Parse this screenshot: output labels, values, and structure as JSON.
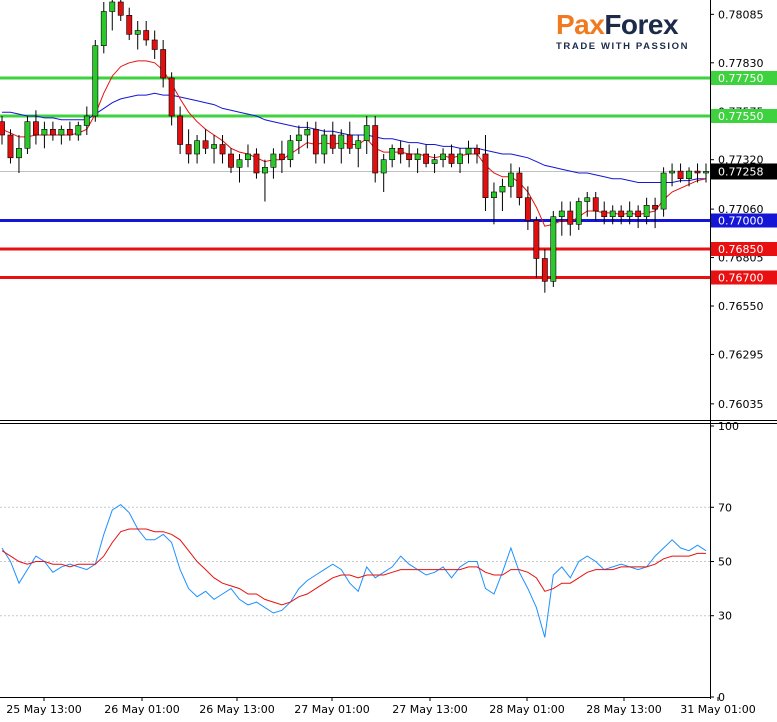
{
  "brand": {
    "name_part1": "Pax",
    "name_part2": "Forex",
    "tagline": "TRADE WITH PASSION",
    "color_primary": "#f07a20",
    "color_secondary": "#1c2b4a"
  },
  "chart_data": [
    {
      "type": "candlestick",
      "symbol_pane": "price",
      "y_ticks": [
        "0.78085",
        "0.77830",
        "0.77575",
        "0.77320",
        "0.77060",
        "0.76805",
        "0.76550",
        "0.76295",
        "0.76035"
      ],
      "ylim": [
        0.7595,
        0.7815
      ],
      "current_price": "0.77258",
      "current_price_value": 0.77258,
      "levels": [
        {
          "label": "0.77750",
          "value": 0.7775,
          "color": "#3fd23f"
        },
        {
          "label": "0.77550",
          "value": 0.7755,
          "color": "#3fd23f"
        },
        {
          "label": "0.77000",
          "value": 0.77,
          "color": "#1515d6"
        },
        {
          "label": "0.76850",
          "value": 0.7685,
          "color": "#e81010"
        },
        {
          "label": "0.76700",
          "value": 0.767,
          "color": "#e81010"
        }
      ],
      "candles": [
        [
          0.7752,
          0.7755,
          0.774,
          0.7745
        ],
        [
          0.7745,
          0.7748,
          0.773,
          0.7733
        ],
        [
          0.7733,
          0.7745,
          0.7725,
          0.7738
        ],
        [
          0.7738,
          0.7755,
          0.7735,
          0.7752
        ],
        [
          0.7752,
          0.7758,
          0.774,
          0.7745
        ],
        [
          0.7745,
          0.7752,
          0.7738,
          0.7748
        ],
        [
          0.7748,
          0.7752,
          0.7742,
          0.7745
        ],
        [
          0.7745,
          0.775,
          0.774,
          0.7748
        ],
        [
          0.7748,
          0.7752,
          0.7742,
          0.7745
        ],
        [
          0.7745,
          0.7752,
          0.7742,
          0.775
        ],
        [
          0.775,
          0.776,
          0.7745,
          0.7755
        ],
        [
          0.7755,
          0.7795,
          0.7752,
          0.7792
        ],
        [
          0.7792,
          0.7815,
          0.7788,
          0.781
        ],
        [
          0.781,
          0.782,
          0.78,
          0.7815
        ],
        [
          0.7815,
          0.782,
          0.7805,
          0.7808
        ],
        [
          0.7808,
          0.7812,
          0.7795,
          0.7798
        ],
        [
          0.7798,
          0.7805,
          0.779,
          0.78
        ],
        [
          0.78,
          0.7805,
          0.7792,
          0.7795
        ],
        [
          0.7795,
          0.78,
          0.7785,
          0.779
        ],
        [
          0.779,
          0.7795,
          0.777,
          0.7775
        ],
        [
          0.7775,
          0.7778,
          0.775,
          0.7755
        ],
        [
          0.7755,
          0.776,
          0.7735,
          0.774
        ],
        [
          0.774,
          0.7748,
          0.773,
          0.7735
        ],
        [
          0.7735,
          0.7745,
          0.773,
          0.7742
        ],
        [
          0.7742,
          0.7748,
          0.7735,
          0.7738
        ],
        [
          0.7738,
          0.7745,
          0.773,
          0.774
        ],
        [
          0.774,
          0.7745,
          0.773,
          0.7735
        ],
        [
          0.7735,
          0.7738,
          0.7725,
          0.7728
        ],
        [
          0.7728,
          0.7735,
          0.772,
          0.7732
        ],
        [
          0.7732,
          0.774,
          0.7728,
          0.7735
        ],
        [
          0.7735,
          0.7738,
          0.7722,
          0.7725
        ],
        [
          0.7725,
          0.7732,
          0.771,
          0.7728
        ],
        [
          0.7728,
          0.7738,
          0.7722,
          0.7735
        ],
        [
          0.7735,
          0.7742,
          0.7725,
          0.7732
        ],
        [
          0.7732,
          0.7745,
          0.7728,
          0.7742
        ],
        [
          0.7742,
          0.775,
          0.7735,
          0.7745
        ],
        [
          0.7745,
          0.7752,
          0.7738,
          0.7748
        ],
        [
          0.7748,
          0.7752,
          0.773,
          0.7735
        ],
        [
          0.7735,
          0.7748,
          0.773,
          0.7745
        ],
        [
          0.7745,
          0.7752,
          0.7735,
          0.7738
        ],
        [
          0.7738,
          0.7748,
          0.773,
          0.7745
        ],
        [
          0.7745,
          0.7752,
          0.7735,
          0.7738
        ],
        [
          0.7738,
          0.7745,
          0.7728,
          0.7742
        ],
        [
          0.7742,
          0.7755,
          0.7735,
          0.775
        ],
        [
          0.775,
          0.7755,
          0.772,
          0.7725
        ],
        [
          0.7725,
          0.7735,
          0.7715,
          0.7732
        ],
        [
          0.7732,
          0.774,
          0.7728,
          0.7738
        ],
        [
          0.7738,
          0.7742,
          0.773,
          0.7735
        ],
        [
          0.7735,
          0.774,
          0.7728,
          0.7732
        ],
        [
          0.7732,
          0.7738,
          0.7725,
          0.7735
        ],
        [
          0.7735,
          0.774,
          0.7728,
          0.773
        ],
        [
          0.773,
          0.7735,
          0.7725,
          0.7732
        ],
        [
          0.7732,
          0.7738,
          0.7728,
          0.7735
        ],
        [
          0.7735,
          0.774,
          0.7728,
          0.773
        ],
        [
          0.773,
          0.7738,
          0.7725,
          0.7735
        ],
        [
          0.7735,
          0.7742,
          0.773,
          0.7738
        ],
        [
          0.7738,
          0.774,
          0.773,
          0.7735
        ],
        [
          0.7735,
          0.7745,
          0.7705,
          0.7712
        ],
        [
          0.7712,
          0.772,
          0.7698,
          0.7715
        ],
        [
          0.7715,
          0.7722,
          0.7705,
          0.7718
        ],
        [
          0.7718,
          0.773,
          0.7712,
          0.7725
        ],
        [
          0.7725,
          0.7728,
          0.7708,
          0.7712
        ],
        [
          0.7712,
          0.7718,
          0.7695,
          0.77
        ],
        [
          0.77,
          0.7702,
          0.767,
          0.768
        ],
        [
          0.768,
          0.7685,
          0.7662,
          0.7668
        ],
        [
          0.7668,
          0.7705,
          0.7665,
          0.7702
        ],
        [
          0.7702,
          0.771,
          0.7692,
          0.7705
        ],
        [
          0.7705,
          0.771,
          0.7692,
          0.7698
        ],
        [
          0.7698,
          0.7712,
          0.7695,
          0.771
        ],
        [
          0.771,
          0.7715,
          0.7702,
          0.7712
        ],
        [
          0.7712,
          0.7715,
          0.77,
          0.7705
        ],
        [
          0.7705,
          0.771,
          0.7698,
          0.7702
        ],
        [
          0.7702,
          0.7708,
          0.7698,
          0.7705
        ],
        [
          0.7705,
          0.7708,
          0.7698,
          0.7702
        ],
        [
          0.7702,
          0.771,
          0.7698,
          0.7705
        ],
        [
          0.7705,
          0.7708,
          0.7696,
          0.7702
        ],
        [
          0.7702,
          0.7712,
          0.7698,
          0.7708
        ],
        [
          0.7708,
          0.7712,
          0.7696,
          0.7706
        ],
        [
          0.7706,
          0.7728,
          0.7702,
          0.7725
        ],
        [
          0.7725,
          0.773,
          0.7718,
          0.7726
        ],
        [
          0.7726,
          0.773,
          0.772,
          0.7722
        ],
        [
          0.7722,
          0.7728,
          0.7718,
          0.7726
        ],
        [
          0.7726,
          0.773,
          0.772,
          0.7725
        ],
        [
          0.7725,
          0.773,
          0.772,
          0.77258
        ]
      ],
      "ma_fast": [
        0.7748,
        0.7746,
        0.7744,
        0.7744,
        0.7745,
        0.7745,
        0.7745,
        0.7745,
        0.7745,
        0.7746,
        0.7748,
        0.7756,
        0.7767,
        0.7776,
        0.7781,
        0.7783,
        0.7784,
        0.7784,
        0.7783,
        0.7779,
        0.7772,
        0.7764,
        0.7757,
        0.7752,
        0.7748,
        0.7745,
        0.7742,
        0.7738,
        0.7736,
        0.7735,
        0.7733,
        0.7731,
        0.7732,
        0.7732,
        0.7735,
        0.7738,
        0.7741,
        0.774,
        0.7741,
        0.774,
        0.7741,
        0.774,
        0.774,
        0.7743,
        0.7738,
        0.7736,
        0.7736,
        0.7736,
        0.7735,
        0.7735,
        0.7734,
        0.7733,
        0.7734,
        0.7733,
        0.7734,
        0.7735,
        0.7735,
        0.7729,
        0.7725,
        0.7723,
        0.7723,
        0.772,
        0.7715,
        0.7707,
        0.7697,
        0.7698,
        0.77,
        0.7699,
        0.7702,
        0.7705,
        0.7705,
        0.7704,
        0.7704,
        0.7703,
        0.7704,
        0.7703,
        0.7704,
        0.7705,
        0.7711,
        0.7715,
        0.7717,
        0.7719,
        0.7721,
        0.7722
      ],
      "ma_slow": [
        0.7757,
        0.7757,
        0.7756,
        0.7755,
        0.7755,
        0.7754,
        0.7754,
        0.7753,
        0.7753,
        0.7753,
        0.7753,
        0.7756,
        0.7759,
        0.7762,
        0.7764,
        0.7765,
        0.7766,
        0.7766,
        0.7767,
        0.7766,
        0.7766,
        0.7765,
        0.7764,
        0.7763,
        0.7762,
        0.7761,
        0.7759,
        0.7758,
        0.7757,
        0.7756,
        0.7755,
        0.7753,
        0.7752,
        0.7751,
        0.775,
        0.7749,
        0.7749,
        0.7748,
        0.7747,
        0.7747,
        0.7746,
        0.7745,
        0.7745,
        0.7745,
        0.7744,
        0.7743,
        0.7743,
        0.7742,
        0.7741,
        0.7741,
        0.774,
        0.774,
        0.7739,
        0.7739,
        0.7738,
        0.7738,
        0.7738,
        0.7737,
        0.7736,
        0.7735,
        0.7735,
        0.7734,
        0.7733,
        0.7731,
        0.7729,
        0.7728,
        0.7727,
        0.7726,
        0.7725,
        0.7725,
        0.7724,
        0.7723,
        0.7722,
        0.7722,
        0.7721,
        0.772,
        0.772,
        0.772,
        0.772,
        0.772,
        0.7721,
        0.7721,
        0.7722,
        0.7722
      ]
    },
    {
      "type": "line",
      "symbol_pane": "oscillator",
      "y_ticks": [
        "100",
        "70",
        "50",
        "30",
        "0"
      ],
      "ylim": [
        0,
        100
      ],
      "grid_levels": [
        70,
        50,
        30
      ],
      "series": [
        {
          "color": "#1e90ff",
          "values": [
            55,
            50,
            42,
            47,
            52,
            50,
            46,
            48,
            49,
            48,
            47,
            49,
            60,
            69,
            71,
            68,
            62,
            58,
            58,
            60,
            57,
            47,
            40,
            37,
            39,
            36,
            38,
            40,
            36,
            34,
            35,
            33,
            31,
            32,
            35,
            40,
            43,
            45,
            47,
            49,
            47,
            42,
            39,
            48,
            44,
            46,
            48,
            52,
            49,
            47,
            45,
            46,
            48,
            44,
            48,
            50,
            50,
            40,
            38,
            46,
            55,
            46,
            40,
            33,
            22,
            45,
            48,
            44,
            50,
            52,
            50,
            47,
            48,
            49,
            48,
            47,
            48,
            52,
            55,
            58,
            55,
            54,
            56,
            54
          ]
        },
        {
          "color": "#e81010",
          "values": [
            54,
            52,
            50,
            49,
            50,
            50,
            49,
            49,
            48,
            49,
            49,
            49,
            52,
            57,
            61,
            62,
            62,
            62,
            61,
            61,
            60,
            58,
            54,
            50,
            47,
            44,
            42,
            41,
            40,
            38,
            38,
            36,
            35,
            34,
            35,
            37,
            38,
            40,
            42,
            44,
            45,
            45,
            44,
            45,
            45,
            45,
            46,
            47,
            47,
            47,
            47,
            47,
            47,
            47,
            47,
            48,
            48,
            46,
            45,
            45,
            47,
            47,
            46,
            44,
            39,
            40,
            42,
            42,
            44,
            46,
            47,
            47,
            47,
            48,
            48,
            48,
            48,
            49,
            51,
            52,
            52,
            52,
            53,
            53
          ]
        }
      ],
      "current_fast": 54,
      "current_slow": 53
    }
  ],
  "x_ticks": [
    "25 May 13:00",
    "26 May 01:00",
    "26 May 13:00",
    "27 May 01:00",
    "27 May 13:00",
    "28 May 01:00",
    "28 May 13:00",
    "31 May 01:00"
  ],
  "colors": {
    "bull_candle": "#2bc82b",
    "bear_candle": "#e01010",
    "ma_fast": "#e81010",
    "ma_slow": "#1515d6",
    "axis": "#000000",
    "grid": "#c8c8c8",
    "current_price_box": "#000000"
  }
}
